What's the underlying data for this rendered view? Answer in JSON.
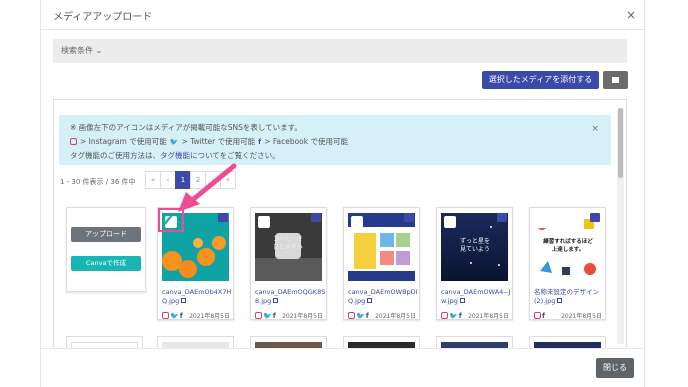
{
  "modal": {
    "title": "メディアアップロード",
    "close": "×"
  },
  "search": {
    "label": "検索条件 ⌄"
  },
  "toolbar": {
    "attach_label": "選択したメディアを添付する"
  },
  "alert": {
    "line1": "※ 画像左下のアイコンはメディアが掲載可能なSNSを表しています。",
    "instagram": "> Instagram で使用可能",
    "twitter": "> Twitter で使用可能",
    "facebook": "> Facebook で使用可能",
    "line3_pre": "タグ機能のご使用方法は、",
    "line3_link": "タグ機能",
    "line3_post": "についてをご覧ください。",
    "close": "×"
  },
  "pagination": {
    "count_text": "1 - 30 件表示 / 36 件中",
    "pages": [
      "«",
      "‹",
      "1",
      "2",
      "›",
      "»"
    ],
    "active": "1"
  },
  "upload": {
    "upload_label": "アップロード",
    "canva_label": "Canvaで作成"
  },
  "cards": [
    {
      "name": "canva_DAEmOb4X7HQ.jpg",
      "date": "2021年8月5日"
    },
    {
      "name": "canva_DAEmOQGK8S8.jpg",
      "date": "2021年8月5日"
    },
    {
      "name": "canva_DAEmOWBpDIQ.jpg",
      "date": "2021年8月5日"
    },
    {
      "name": "canva_DAEmOWA4--Jw.jpg",
      "date": "2021年8月5日"
    },
    {
      "name": "名称未設定のデザイン (2).jpg",
      "date": "2021年8月5日"
    }
  ],
  "thumb_texts": {
    "card2": "コーヒーで\nひとやすみ",
    "card4": "ずっと星を\n見ていよう",
    "card5": "練習すればするほど\n上達します。"
  },
  "footer": {
    "close_label": "閉じる"
  },
  "colors": {
    "primary": "#3b4aa8",
    "teal": "#18b5b4",
    "alert_bg": "#d6f0f8",
    "highlight": "#ee4d95"
  }
}
